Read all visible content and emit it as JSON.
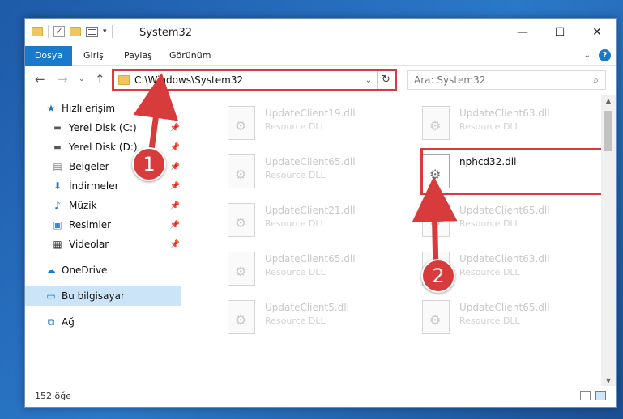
{
  "window": {
    "title": "System32",
    "controls": {
      "minimize": "—",
      "maximize": "☐",
      "close": "✕"
    }
  },
  "ribbon": {
    "tabs": [
      "Dosya",
      "Giriş",
      "Paylaş",
      "Görünüm"
    ],
    "expand_icon": "chevron-down-icon",
    "help_label": "?"
  },
  "navigation": {
    "address_path": "C:\\Windows\\System32",
    "search_placeholder": "Ara: System32"
  },
  "sidebar": {
    "items": [
      {
        "label": "Hızlı erişim",
        "icon": "star-icon",
        "pinned": false
      },
      {
        "label": "Yerel Disk (C:)",
        "icon": "drive-icon",
        "pinned": true
      },
      {
        "label": "Yerel Disk (D:)",
        "icon": "drive-icon",
        "pinned": true
      },
      {
        "label": "Belgeler",
        "icon": "document-icon",
        "pinned": true
      },
      {
        "label": "İndirmeler",
        "icon": "download-icon",
        "pinned": true
      },
      {
        "label": "Müzik",
        "icon": "music-icon",
        "pinned": true
      },
      {
        "label": "Resimler",
        "icon": "pictures-icon",
        "pinned": true
      },
      {
        "label": "Videolar",
        "icon": "video-icon",
        "pinned": true
      },
      {
        "label": "OneDrive",
        "icon": "cloud-icon",
        "pinned": false
      },
      {
        "label": "Bu bilgisayar",
        "icon": "computer-icon",
        "pinned": false,
        "selected": true
      },
      {
        "label": "Ağ",
        "icon": "network-icon",
        "pinned": false
      }
    ]
  },
  "files": [
    {
      "name": "UpdateClient19.dll",
      "type": "Resource DLL"
    },
    {
      "name": "UpdateClient63.dll",
      "type": "Resource DLL"
    },
    {
      "name": "UpdateClient65.dll",
      "type": "Resource DLL"
    },
    {
      "name": "nphcd32.dll",
      "type": "",
      "highlighted": true
    },
    {
      "name": "UpdateClient21.dll",
      "type": "Resource DLL"
    },
    {
      "name": "UpdateClient65.dll",
      "type": "Resource DLL"
    },
    {
      "name": "UpdateClient65.dll",
      "type": "Resource DLL"
    },
    {
      "name": "UpdateClient63.dll",
      "type": "Resource DLL"
    },
    {
      "name": "UpdateClient5.dll",
      "type": "Resource DLL"
    },
    {
      "name": "UpdateClient65.dll",
      "type": "Resource DLL"
    }
  ],
  "status": {
    "item_count": "152 öğe"
  },
  "annotations": {
    "step1": "1",
    "step2": "2",
    "color": "#d73b3b"
  }
}
